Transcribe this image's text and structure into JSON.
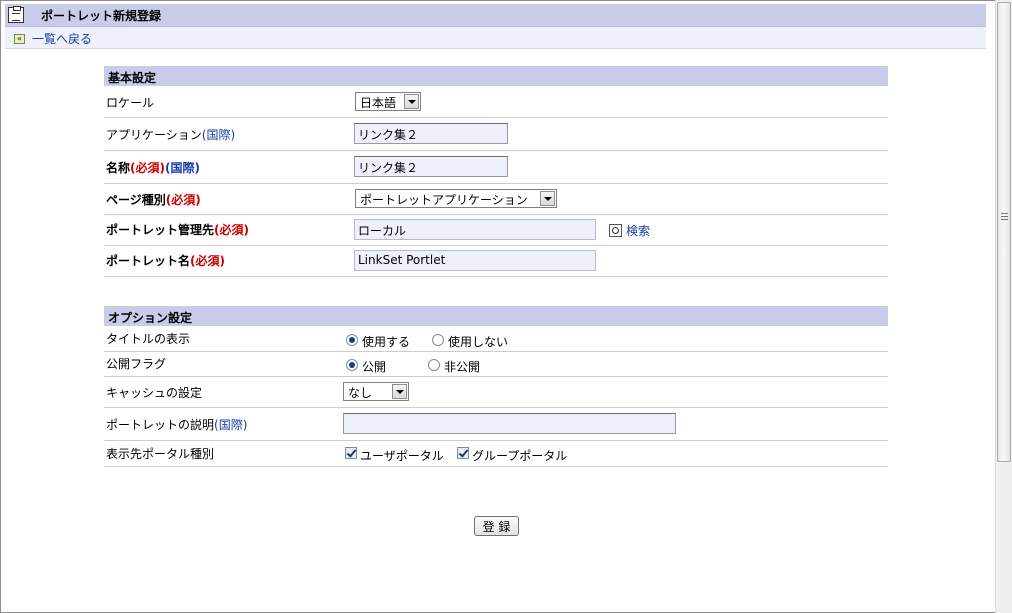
{
  "header": {
    "title": "ポートレット新規登録",
    "back_label": "一覧へ戻る"
  },
  "basic": {
    "section_title": "基本設定",
    "locale_label": "ロケール",
    "locale_value": "日本語",
    "app_label": "アプリケーション",
    "app_intl": "(国際)",
    "app_value": "リンク集２",
    "name_label": "名称",
    "name_req": "(必須)",
    "name_intl": "(国際)",
    "name_value": "リンク集２",
    "page_type_label": "ページ種別",
    "page_type_req": "(必須)",
    "page_type_value": "ポートレットアプリケーション",
    "manager_label": "ポートレット管理先",
    "manager_req": "(必須)",
    "manager_value": "ローカル",
    "search_label": "検索",
    "portlet_name_label": "ポートレット名",
    "portlet_name_req": "(必須)",
    "portlet_name_value": "LinkSet Portlet"
  },
  "options": {
    "section_title": "オプション設定",
    "title_display_label": "タイトルの表示",
    "title_display_on": "使用する",
    "title_display_off": "使用しない",
    "publish_label": "公開フラグ",
    "publish_on": "公開",
    "publish_off": "非公開",
    "cache_label": "キャッシュの設定",
    "cache_value": "なし",
    "desc_label": "ポートレットの説明",
    "desc_intl": "(国際)",
    "desc_value": "",
    "portal_type_label": "表示先ポータル種別",
    "portal_user": "ユーザポータル",
    "portal_group": "グループポータル"
  },
  "submit_label": "登 録"
}
